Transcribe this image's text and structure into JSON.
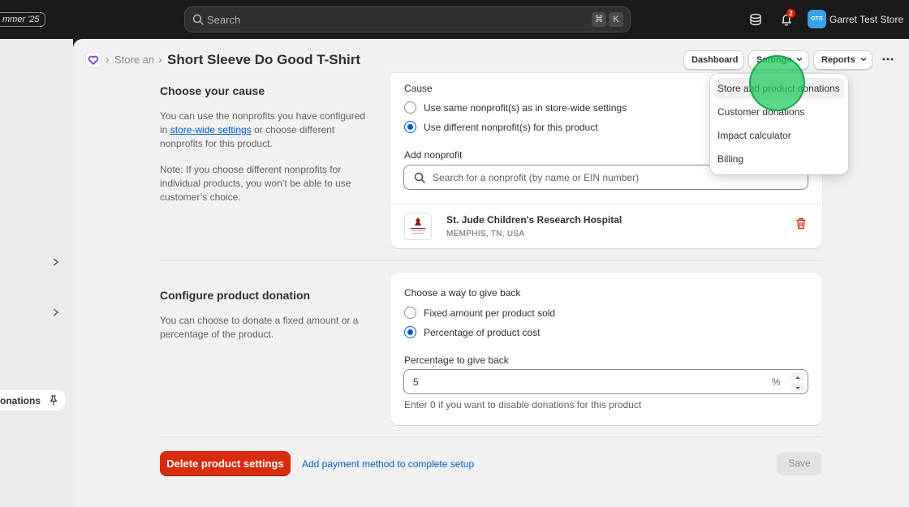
{
  "topbar": {
    "edition_badge": "mmer '25",
    "search_placeholder": "Search",
    "kbd_cmd": "⌘",
    "kbd_k": "K",
    "notification_count": "2",
    "avatar_initials": "GTS",
    "store_name": "Garret Test Store"
  },
  "leftnav": {
    "pinned_label": "onations"
  },
  "header": {
    "breadcrumb_store": "Store an",
    "breadcrumb_sep": "›",
    "page_title": "Short Sleeve Do Good T-Shirt",
    "dashboard_label": "Dashboard",
    "settings_label": "Settings",
    "reports_label": "Reports"
  },
  "settings_menu": {
    "items": [
      "Store and product donations",
      "Customer donations",
      "Impact calculator",
      "Billing"
    ]
  },
  "cause_section": {
    "title": "Choose your cause",
    "desc_before": "You can use the nonprofits you have configured in ",
    "desc_link": "store-wide settings",
    "desc_after": " or choose different nonprofits for this product.",
    "note": "Note: If you choose different nonprofits for individual products, you won’t be able to use customer’s choice.",
    "cause_label": "Cause",
    "option_same": "Use same nonprofit(s) as in store-wide settings",
    "option_different": "Use different nonprofit(s) for this product",
    "add_nonprofit_label": "Add nonprofit",
    "search_placeholder": "Search for a nonprofit (by name or EIN number)",
    "nonprofit": {
      "name": "St. Jude Children's Research Hospital",
      "location": "MEMPHIS, TN, USA",
      "logo_text": "St. Jude Children's Research Hospital"
    }
  },
  "donation_section": {
    "title": "Configure product donation",
    "desc": "You can choose to donate a fixed amount or a percentage of the product.",
    "give_back_label": "Choose a way to give back",
    "option_fixed": "Fixed amount per product sold",
    "option_percentage": "Percentage of product cost",
    "percentage_label": "Percentage to give back",
    "percentage_value": "5",
    "percentage_suffix": "%",
    "help_text": "Enter 0 if you want to disable donations for this product"
  },
  "footer": {
    "delete_label": "Delete product settings",
    "payment_link": "Add payment method to complete setup",
    "save_label": "Save"
  },
  "colors": {
    "accent": "#005bd3",
    "danger": "#d72c0d",
    "cursor": "#23c85f"
  }
}
